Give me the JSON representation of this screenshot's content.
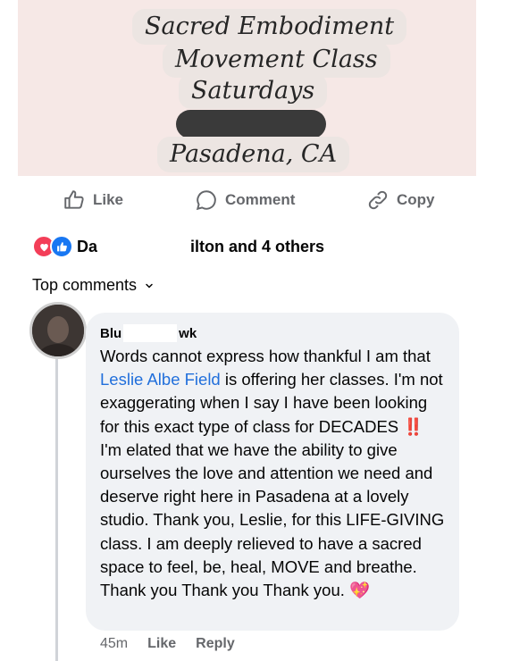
{
  "post": {
    "banner_lines": [
      "Sacred Embodiment",
      "Movement Class",
      "Saturdays",
      "Pasadena, CA"
    ],
    "banner_background": "#f6e8e6"
  },
  "actions": {
    "like": "Like",
    "comment": "Comment",
    "copy": "Copy"
  },
  "reactions": {
    "names_prefix": "Dа",
    "names_suffix": "ilton and 4 others",
    "icons": [
      "heart-icon",
      "thumbs-up-icon"
    ]
  },
  "comments_header": {
    "sort_label": "Top comments"
  },
  "comment": {
    "author_start": "Blu",
    "author_end": "wk",
    "text_before": "Words cannot express how thankful I am that ",
    "mention": "Leslie Albe Field",
    "text_middle": " is offering her classes. I'm not exaggerating when I say I have been looking for this exact type of class for DECADES ",
    "emoji1": "‼️",
    "text_after": " I'm elated that we have the ability to give ourselves the love and attention we need and deserve right here in Pasadena at a lovely studio. Thank you, Leslie, for this LIFE-GIVING class. I am deeply relieved to have a sacred space to feel, be, heal, MOVE and breathe. Thank you Thank you Thank you. ",
    "emoji2": "💖",
    "time": "45m",
    "like_label": "Like",
    "reply_label": "Reply"
  },
  "colors": {
    "accent_link": "#216fdb",
    "meta_gray": "#65676b",
    "bubble": "#f0f2f5"
  }
}
